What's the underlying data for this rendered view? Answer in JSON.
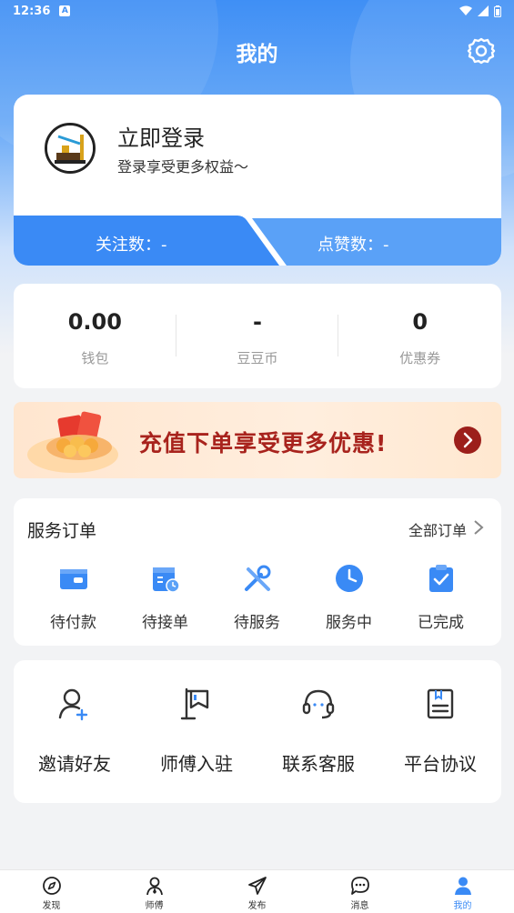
{
  "status_bar": {
    "time": "12:36",
    "notif": "A"
  },
  "header": {
    "title": "我的"
  },
  "login_card": {
    "title": "立即登录",
    "subtitle": "登录享受更多权益～",
    "follow_label": "关注数：-",
    "like_label": "点赞数：-"
  },
  "wallet": {
    "items": [
      {
        "value": "0.00",
        "label": "钱包"
      },
      {
        "value": "-",
        "label": "豆豆币"
      },
      {
        "value": "0",
        "label": "优惠券"
      }
    ]
  },
  "promo": {
    "text": "充值下单享受更多优惠!"
  },
  "orders": {
    "title": "服务订单",
    "all_label": "全部订单",
    "items": [
      {
        "label": "待付款",
        "icon": "wallet-icon"
      },
      {
        "label": "待接单",
        "icon": "calendar-clock-icon"
      },
      {
        "label": "待服务",
        "icon": "tools-icon"
      },
      {
        "label": "服务中",
        "icon": "clock-icon"
      },
      {
        "label": "已完成",
        "icon": "clipboard-check-icon"
      }
    ]
  },
  "tools": {
    "items": [
      {
        "label": "邀请好友",
        "icon": "add-user-icon"
      },
      {
        "label": "师傅入驻",
        "icon": "flag-icon"
      },
      {
        "label": "联系客服",
        "icon": "headset-icon"
      },
      {
        "label": "平台协议",
        "icon": "document-icon"
      }
    ]
  },
  "tabbar": {
    "items": [
      {
        "label": "发现",
        "icon": "compass-icon"
      },
      {
        "label": "师傅",
        "icon": "worker-icon"
      },
      {
        "label": "发布",
        "icon": "send-icon"
      },
      {
        "label": "消息",
        "icon": "chat-icon"
      },
      {
        "label": "我的",
        "icon": "user-icon"
      }
    ],
    "active_index": 4
  },
  "colors": {
    "primary": "#3a8af5",
    "promo_text": "#a8231d",
    "promo_button": "#9c1f1b"
  }
}
